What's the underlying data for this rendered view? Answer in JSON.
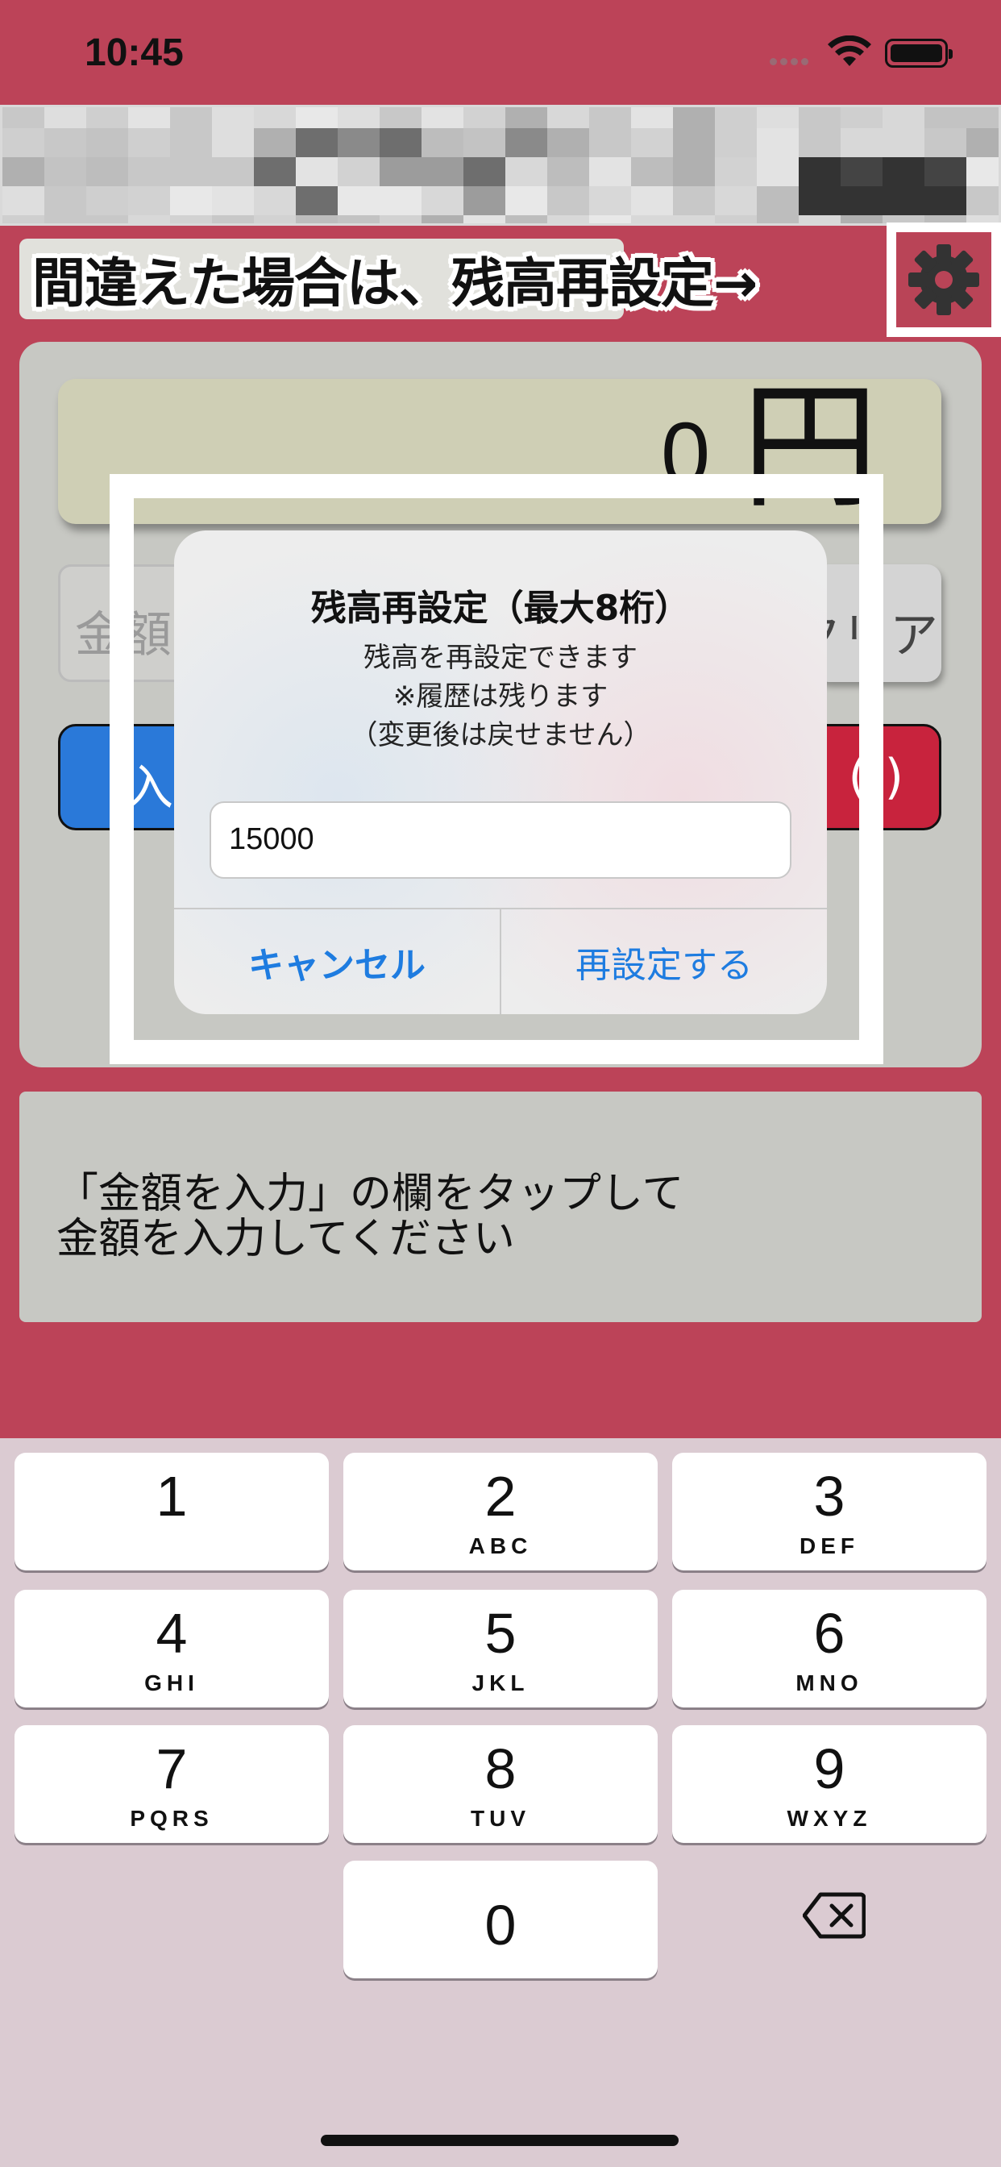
{
  "status_bar": {
    "time": "10:45"
  },
  "annotation": {
    "text": "間違えた場合は、残高再設定→",
    "icon": "gear-icon"
  },
  "balance": {
    "amount": "0",
    "unit": "円"
  },
  "amount_field": {
    "placeholder": "金額"
  },
  "buttons": {
    "clear": "クリア",
    "deposit": "入金",
    "withdraw": "(-)"
  },
  "alert": {
    "title": "残高再設定（最大8桁）",
    "message_lines": [
      "残高を再設定できます",
      "※履歴は残ります",
      "（変更後は戻せません）"
    ],
    "input_value": "15000",
    "cancel_label": "キャンセル",
    "confirm_label": "再設定する"
  },
  "info": {
    "lines": [
      "「金額を入力」の欄をタップして",
      "金額を入力してください"
    ]
  },
  "keyboard": {
    "keys": [
      {
        "digit": "1",
        "letters": ""
      },
      {
        "digit": "2",
        "letters": "ABC"
      },
      {
        "digit": "3",
        "letters": "DEF"
      },
      {
        "digit": "4",
        "letters": "GHI"
      },
      {
        "digit": "5",
        "letters": "JKL"
      },
      {
        "digit": "6",
        "letters": "MNO"
      },
      {
        "digit": "7",
        "letters": "PQRS"
      },
      {
        "digit": "8",
        "letters": "TUV"
      },
      {
        "digit": "9",
        "letters": "WXYZ"
      },
      {
        "digit": "0",
        "letters": ""
      }
    ],
    "delete_icon": "backspace-icon"
  },
  "colors": {
    "background": "#bc4358",
    "panel": "#c7c8c3",
    "accent": "#1e7ce0",
    "deposit": "#2a79d9",
    "withdraw": "#c8233d"
  }
}
